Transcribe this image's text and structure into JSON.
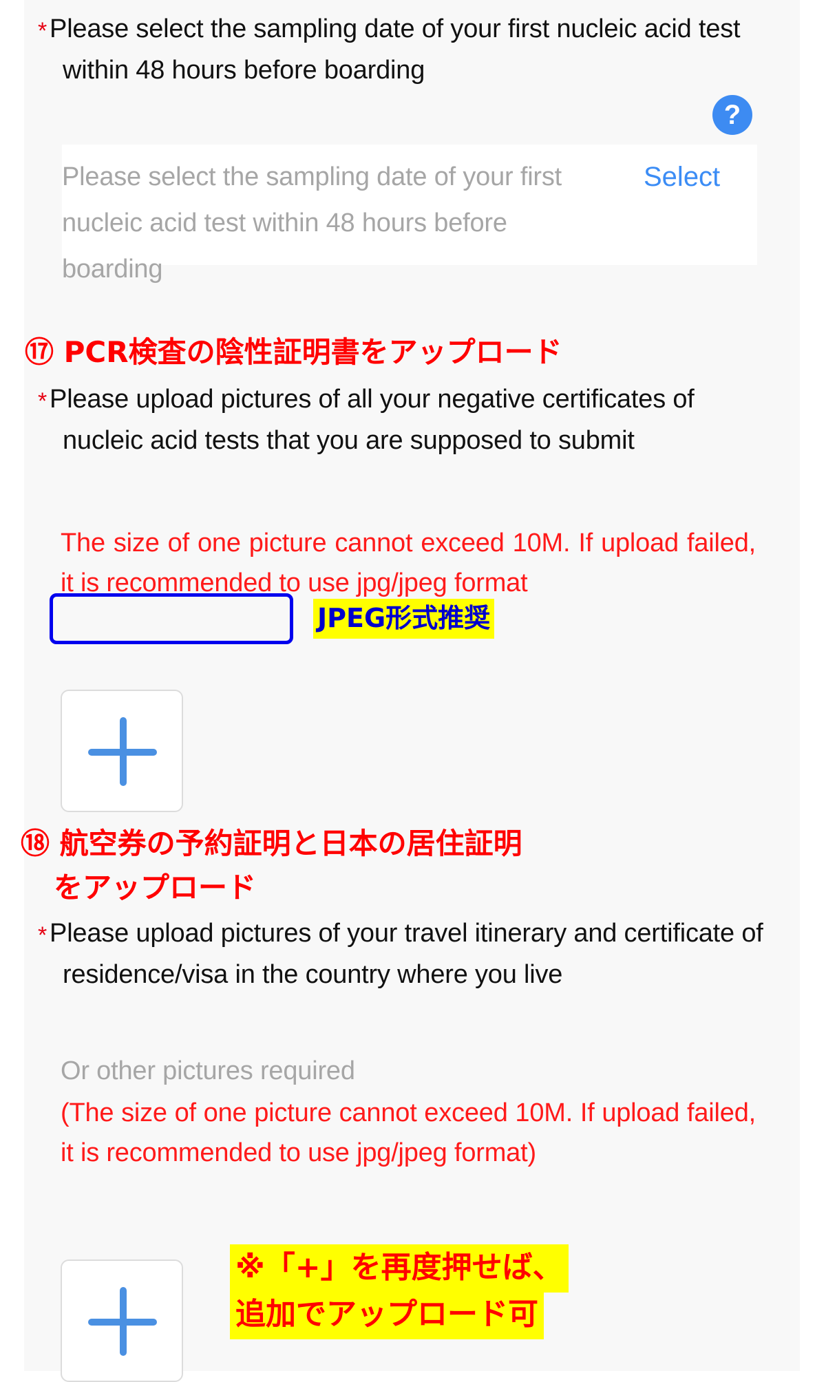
{
  "section_date": {
    "required_label": "Please select the sampling date of your first nucleic acid test within 48 hours before boarding",
    "required_star": "*",
    "help_icon": "?",
    "field_placeholder": "Please select the sampling date of your first nucleic acid test within 48 hours before boarding",
    "select_label": "Select"
  },
  "annotation_17": "⑰ PCR検査の陰性証明書をアップロード",
  "section_pcr": {
    "required_star": "*",
    "required_label": "Please upload pictures of all your negative certificates of nucleic acid tests that you are supposed to submit",
    "warning": "The size of one picture cannot exceed 10M. If upload failed, it is recommended to use jpg/jpeg format",
    "highlight_jpeg": "JPEG形式推奨",
    "upload_plus": "+"
  },
  "annotation_18_line1": "⑱ 航空券の予約証明と日本の居住証明",
  "annotation_18_line2": "をアップロード",
  "section_itinerary": {
    "required_star": "*",
    "required_label": "Please upload pictures of your travel itinerary and certificate of residence/visa in the country where you live",
    "hint": "Or other pictures required",
    "warning": "(The size of one picture cannot exceed 10M. If upload failed, it is recommended to use jpg/jpeg format)",
    "upload_plus": "+"
  },
  "annotation_plus_line1": "※「+」を再度押せば、",
  "annotation_plus_line2": "追加でアップロード可",
  "colors": {
    "accent_blue": "#3d8bf2",
    "link_blue": "#3b8cf5",
    "warning_red": "#ff1a1a",
    "annotation_red": "#ff0000",
    "highlight_yellow": "#ffff00",
    "emphasis_box_blue": "#0000ee",
    "placeholder_grey": "#a6a6a6"
  }
}
